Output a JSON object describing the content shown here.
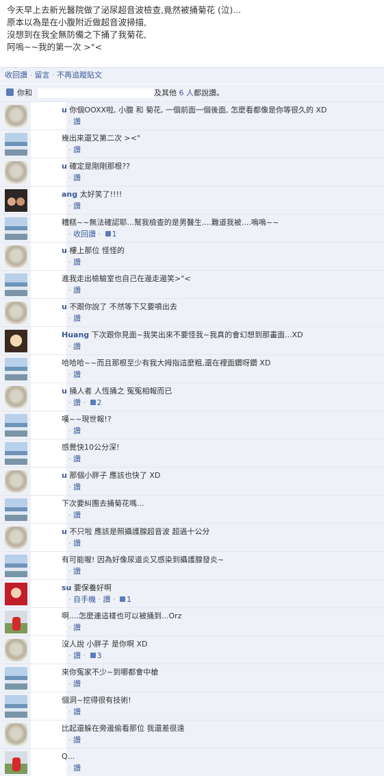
{
  "status": {
    "lines": [
      "今天早上去新光醫院做了泌尿超音波檢查,竟然被捅菊花 (泣)...",
      "原本以為是在小腹附近做超音波掃描,",
      "沒想到在我全無防備之下捅了我菊花,",
      "阿嗚~~我的第一次 >\"<"
    ]
  },
  "actions": {
    "withdraw_like": "收回讚",
    "comment": "留言",
    "unfollow": "不再追蹤貼文"
  },
  "likes": {
    "prefix": "你和",
    "and_others": "及其他",
    "count_link": "6 人",
    "suffix": "都說讚。"
  },
  "comments": [
    {
      "avatar": "buddha",
      "name": "u",
      "text": "你個OOXX啦, 小腹 和 菊花, 一個前面一個後面, 怎麼看都像是你等很久的 XD",
      "meta": "讚"
    },
    {
      "avatar": "landscape",
      "name": "",
      "text": "幾出來還又第二次 ><\"",
      "meta": "讚"
    },
    {
      "avatar": "buddha",
      "name": "u",
      "text": "確定是剛剛那根??",
      "meta": "讚"
    },
    {
      "avatar": "girls",
      "name": "ang",
      "text": "太好笑了!!!!",
      "meta": "讚"
    },
    {
      "avatar": "landscape",
      "name": "",
      "text": "糟糕~~無法確認耶...幫我檢查的是男醫生....難道我被....嗚嗚~~",
      "meta": "收回讚",
      "count": "1"
    },
    {
      "avatar": "buddha",
      "name": "u",
      "text": "樓上那位 怪怪的",
      "meta": "讚"
    },
    {
      "avatar": "landscape",
      "name": "",
      "text": "進我走出檢驗室也自己在邊走邊笑>\"<",
      "meta": "讚"
    },
    {
      "avatar": "buddha",
      "name": "u",
      "text": "不跟你說了 不然等下又要噴出去",
      "meta": "讚"
    },
    {
      "avatar": "cartoon",
      "name": "Huang",
      "text": "下次跟你見面~我笑出來不要怪我~我真的會幻想到那畫面...XD",
      "meta": "讚"
    },
    {
      "avatar": "landscape",
      "name": "",
      "text": "哈哈哈~~而且那根至少有我大拇指這麼粗,還在裡面鑽呀鑽 XD",
      "meta": "讚"
    },
    {
      "avatar": "buddha",
      "name": "u",
      "text": "捅人者 人恆捅之 冤冤相報而已",
      "meta": "讚",
      "count": "2"
    },
    {
      "avatar": "landscape",
      "name": "",
      "text": "嘆~~現世報!?",
      "meta": "讚"
    },
    {
      "avatar": "landscape",
      "name": "",
      "text": "感覺快10公分深!",
      "meta": "讚"
    },
    {
      "avatar": "buddha",
      "name": "u",
      "text": "那個小胖子 應該也快了 XD",
      "meta": "讚"
    },
    {
      "avatar": "landscape",
      "name": "",
      "text": "下次要糾團去捅菊花嗎...",
      "meta": "讚"
    },
    {
      "avatar": "buddha",
      "name": "u",
      "text": "不只啦 應該是照攝護腺超音波 超過十公分",
      "meta": "讚"
    },
    {
      "avatar": "landscape",
      "name": "",
      "text": "有可能喔! 因為好像尿道炎又感染到攝護腺發炎~",
      "meta": "讚"
    },
    {
      "avatar": "red",
      "name": "su",
      "text": "要保養好啊",
      "meta": "自手機",
      "meta2": "讚",
      "count": "1"
    },
    {
      "avatar": "person",
      "name": "",
      "text": "啊....怎麼連這樣也可以被捅到...Orz",
      "meta": "讚"
    },
    {
      "avatar": "buddha",
      "name": "",
      "text": "沒人說 小胖子 是你啊 XD",
      "meta": "讚",
      "count": "3"
    },
    {
      "avatar": "landscape",
      "name": "",
      "text": "來你冤家不少~到哪都會中槍",
      "meta": "讚"
    },
    {
      "avatar": "landscape",
      "name": "",
      "text": "個洞~挖得很有技術!",
      "meta": "讚"
    },
    {
      "avatar": "buddha",
      "name": "",
      "text": "比起還躲在旁邊偷看那位 我還差很遠",
      "meta": "讚"
    },
    {
      "avatar": "person",
      "name": "",
      "text": "Q...",
      "meta": "讚"
    }
  ]
}
